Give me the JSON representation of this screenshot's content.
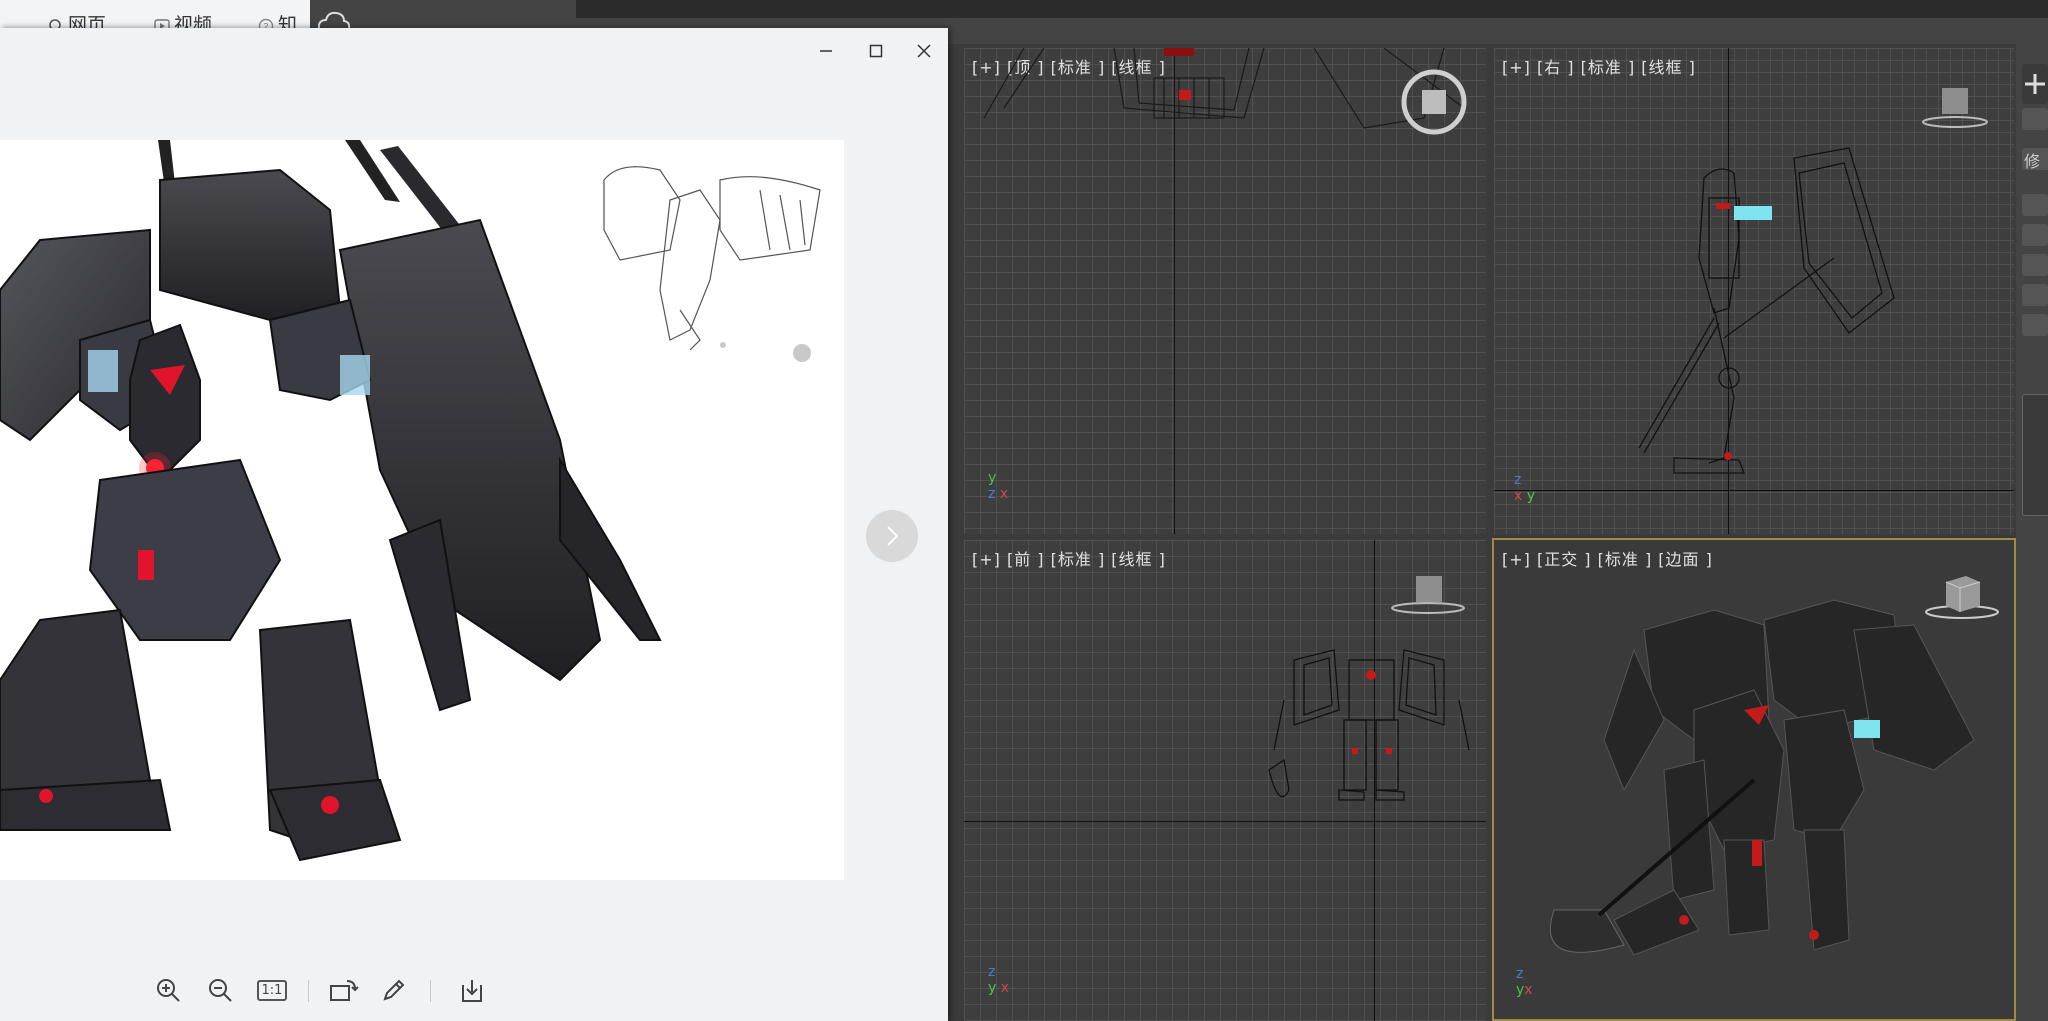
{
  "browser": {
    "tabs": [
      {
        "label": "网页",
        "icon": "search-icon"
      },
      {
        "label": "视频",
        "icon": "play-icon"
      },
      {
        "label": "知",
        "icon": "question-icon"
      }
    ]
  },
  "viewports": [
    {
      "id": "top",
      "label": "[+] [顶 ] [标准 ] [线框 ]"
    },
    {
      "id": "right",
      "label": "[+] [右 ] [标准 ] [线框 ]"
    },
    {
      "id": "front",
      "label": "[+] [前 ] [标准 ] [线框 ]"
    },
    {
      "id": "persp",
      "label": "[+] [正交 ] [标准 ] [边面 ]"
    }
  ],
  "gizmos": {
    "top": {
      "a": "y",
      "b": "z",
      "c": "x"
    },
    "right": {
      "a": "z",
      "b": "x",
      "c": "y"
    },
    "front": {
      "a": "z",
      "b": "y",
      "c": "x"
    },
    "persp": {
      "a": "z",
      "b": "y",
      "c": "x"
    }
  },
  "command_panel": {
    "tab_label": "修"
  },
  "viewer": {
    "toolbar": {
      "zoom_in": "zoom-in-icon",
      "zoom_out": "zoom-out-icon",
      "actual_size": "1:1",
      "rotate": "rotate-icon",
      "edit": "pencil-icon",
      "download": "download-icon"
    }
  },
  "colors": {
    "viewport_bg": "#3e3e3e",
    "grid": "#505050",
    "active_border": "#a08a4a",
    "viewer_bg": "#f1f2f4",
    "accent_red": "#e0142a",
    "accent_cyan": "#7fe3f0"
  }
}
